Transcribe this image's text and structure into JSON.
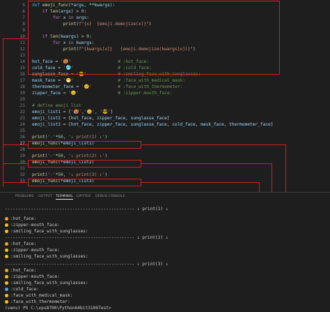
{
  "editor": {
    "lines": [
      {
        "n": "5",
        "t": [
          [
            "k",
            "def "
          ],
          [
            "f",
            "emoji_func"
          ],
          [
            "",
            "(*"
          ],
          [
            "p",
            "args"
          ],
          [
            "",
            ", **"
          ],
          [
            "p",
            "kwargs"
          ],
          [
            "",
            "):"
          ]
        ]
      },
      {
        "n": "6",
        "t": [
          [
            "",
            "    "
          ],
          [
            "kw2",
            "if "
          ],
          [
            "f",
            "len"
          ],
          [
            "",
            "("
          ],
          [
            "p",
            "args"
          ],
          [
            "",
            ") > "
          ],
          [
            "n",
            "0"
          ],
          [
            "",
            ":"
          ]
        ]
      },
      {
        "n": "7",
        "t": [
          [
            "",
            "        "
          ],
          [
            "kw2",
            "for "
          ],
          [
            "p",
            "x"
          ],
          [
            "kw2",
            " in "
          ],
          [
            "p",
            "args"
          ],
          [
            "",
            ":"
          ]
        ]
      },
      {
        "n": "8",
        "t": [
          [
            "",
            "            "
          ],
          [
            "f",
            "print"
          ],
          [
            "",
            "("
          ],
          [
            "s",
            "f\"{x}  {emoji.demojize(x)}\""
          ],
          [
            "",
            ")"
          ]
        ]
      },
      {
        "n": "9",
        "t": []
      },
      {
        "n": "10",
        "t": [
          [
            "",
            "    "
          ],
          [
            "kw2",
            "if "
          ],
          [
            "f",
            "len"
          ],
          [
            "",
            "("
          ],
          [
            "p",
            "kwargs"
          ],
          [
            "",
            ") > "
          ],
          [
            "n",
            "0"
          ],
          [
            "",
            ":"
          ]
        ]
      },
      {
        "n": "11",
        "t": [
          [
            "",
            "        "
          ],
          [
            "kw2",
            "for "
          ],
          [
            "p",
            "x"
          ],
          [
            "kw2",
            " in "
          ],
          [
            "p",
            "kwargs"
          ],
          [
            "",
            ":"
          ]
        ]
      },
      {
        "n": "12",
        "t": [
          [
            "",
            "            "
          ],
          [
            "f",
            "print"
          ],
          [
            "",
            "("
          ],
          [
            "s",
            "f\"{kwargs[x]}   {emoji.demojize(kwargs[x])}\""
          ],
          [
            "",
            ")"
          ]
        ]
      },
      {
        "n": "13",
        "t": []
      },
      {
        "n": "14",
        "t": [
          [
            "p",
            "hot_face"
          ],
          [
            "",
            " = "
          ],
          [
            "s",
            "'🥵'"
          ],
          [
            "",
            "                  "
          ],
          [
            "c",
            "# :hot_face:"
          ]
        ]
      },
      {
        "n": "15",
        "t": [
          [
            "p",
            "cold_face"
          ],
          [
            "",
            " = "
          ],
          [
            "s",
            "'🥶'"
          ],
          [
            "",
            "                 "
          ],
          [
            "c",
            "# :cold_face:"
          ]
        ]
      },
      {
        "n": "16",
        "t": [
          [
            "p",
            "sunglasse_face"
          ],
          [
            "",
            " = "
          ],
          [
            "s",
            "'😎'"
          ],
          [
            "",
            "            "
          ],
          [
            "c",
            "# :smiling_face_with_sunglasses:"
          ]
        ]
      },
      {
        "n": "17",
        "t": [
          [
            "p",
            "mask_face"
          ],
          [
            "",
            " = "
          ],
          [
            "s",
            "'😷'"
          ],
          [
            "",
            "                 "
          ],
          [
            "c",
            "# :face_with_medical_mask:"
          ]
        ]
      },
      {
        "n": "18",
        "t": [
          [
            "p",
            "thermometer_face"
          ],
          [
            "",
            " = "
          ],
          [
            "s",
            "'🤒'"
          ],
          [
            "",
            "          "
          ],
          [
            "c",
            "# :face_with_thermometer:"
          ]
        ]
      },
      {
        "n": "19",
        "t": [
          [
            "p",
            "zipper_face"
          ],
          [
            "",
            " = "
          ],
          [
            "s",
            "'🤐'"
          ],
          [
            "",
            "               "
          ],
          [
            "c",
            "# :zipper-mouth_face:"
          ]
        ]
      },
      {
        "n": "20",
        "t": []
      },
      {
        "n": "21",
        "t": [
          [
            "c",
            "# define emoji list"
          ]
        ]
      },
      {
        "n": "22",
        "t": [
          [
            "p",
            "emoji_list1"
          ],
          [
            "",
            " = ["
          ],
          [
            "s",
            "'🥵'"
          ],
          [
            "",
            ","
          ],
          [
            "s",
            "'🤐'"
          ],
          [
            "",
            ", "
          ],
          [
            "s",
            "'😎'"
          ],
          [
            "",
            "]"
          ]
        ]
      },
      {
        "n": "23",
        "t": [
          [
            "p",
            "emoji_list2"
          ],
          [
            "",
            " = ["
          ],
          [
            "p",
            "hot_face"
          ],
          [
            "",
            ", "
          ],
          [
            "p",
            "zipper_face"
          ],
          [
            "",
            ", "
          ],
          [
            "p",
            "sunglasse_face"
          ],
          [
            "",
            "]"
          ]
        ]
      },
      {
        "n": "24",
        "t": [
          [
            "p",
            "emoji_list3"
          ],
          [
            "",
            " = ["
          ],
          [
            "p",
            "hot_face"
          ],
          [
            "",
            ", "
          ],
          [
            "p",
            "zipper_face"
          ],
          [
            "",
            ", "
          ],
          [
            "p",
            "sunglasse_face"
          ],
          [
            "",
            ", "
          ],
          [
            "p",
            "cold_face"
          ],
          [
            "",
            ", "
          ],
          [
            "p",
            "mask_face"
          ],
          [
            "",
            ", "
          ],
          [
            "p",
            "thermometer_face"
          ],
          [
            "",
            "]"
          ]
        ]
      },
      {
        "n": "25",
        "t": []
      },
      {
        "n": "26",
        "t": [
          [
            "f",
            "print"
          ],
          [
            "",
            "("
          ],
          [
            "s",
            "'-'"
          ],
          [
            "",
            "*"
          ],
          [
            "n",
            "50"
          ],
          [
            "",
            ", "
          ],
          [
            "s",
            "'↓ print(1) ↓'"
          ],
          [
            "",
            ")"
          ]
        ]
      },
      {
        "n": "27",
        "t": [
          [
            "f",
            "emoji_func"
          ],
          [
            "",
            "(*"
          ],
          [
            "p",
            "emoji_list1"
          ],
          [
            "",
            ")"
          ]
        ]
      },
      {
        "n": "28",
        "t": []
      },
      {
        "n": "29",
        "t": [
          [
            "f",
            "print"
          ],
          [
            "",
            "("
          ],
          [
            "s",
            "'-'"
          ],
          [
            "",
            "*"
          ],
          [
            "n",
            "50"
          ],
          [
            "",
            ", "
          ],
          [
            "s",
            "'↓ print(2) ↓'"
          ],
          [
            "",
            ")"
          ]
        ]
      },
      {
        "n": "30",
        "t": [
          [
            "f",
            "emoji_func"
          ],
          [
            "",
            "(*"
          ],
          [
            "p",
            "emoji_list2"
          ],
          [
            "",
            ")"
          ]
        ]
      },
      {
        "n": "31",
        "t": []
      },
      {
        "n": "32",
        "t": [
          [
            "f",
            "print"
          ],
          [
            "",
            "("
          ],
          [
            "s",
            "'-'"
          ],
          [
            "",
            "*"
          ],
          [
            "n",
            "50"
          ],
          [
            "",
            ", "
          ],
          [
            "s",
            "'↓ print(3) ↓'"
          ],
          [
            "",
            ")"
          ]
        ]
      },
      {
        "n": "33",
        "t": [
          [
            "f",
            "emoji_func"
          ],
          [
            "",
            "(*"
          ],
          [
            "p",
            "emoji_list3"
          ],
          [
            "",
            ")"
          ]
        ]
      }
    ]
  },
  "panel": {
    "tabs": [
      "PROBLEMS",
      "OUTPUT",
      "TERMINAL",
      "JUPYTER",
      "DEBUG CONSOLE"
    ],
    "active_tab": "TERMINAL"
  },
  "terminal": {
    "lines": [
      {
        "text": "-------------------------------------------------- ↓ print(1) ↓"
      },
      {
        "icon": "#f5a623",
        "text": ":hot_face:"
      },
      {
        "icon": "#f5c518",
        "text": ":zipper-mouth_face:"
      },
      {
        "icon": "#f5c518",
        "text": ":smiling_face_with_sunglasses:"
      },
      {
        "text": "-------------------------------------------------- ↓ print(2) ↓"
      },
      {
        "icon": "#f5a623",
        "text": ":hot_face:"
      },
      {
        "icon": "#f5c518",
        "text": ":zipper-mouth_face:"
      },
      {
        "icon": "#f5c518",
        "text": ":smiling_face_with_sunglasses:"
      },
      {
        "text": "-------------------------------------------------- ↓ print(3) ↓"
      },
      {
        "icon": "#f5a623",
        "text": ":hot_face:"
      },
      {
        "icon": "#f5c518",
        "text": ":zipper-mouth_face:"
      },
      {
        "icon": "#f5c518",
        "text": ":smiling_face_with_sunglasses:"
      },
      {
        "icon": "#5aa0e6",
        "text": ":cold_face:"
      },
      {
        "icon": "#f5c518",
        "text": ":face_with_medical_mask:"
      },
      {
        "icon": "#f5c518",
        "text": ":face_with_thermometer:"
      },
      {
        "text": "(venv) PS C:\\xps8700\\Python64bit3106Test> "
      }
    ]
  }
}
